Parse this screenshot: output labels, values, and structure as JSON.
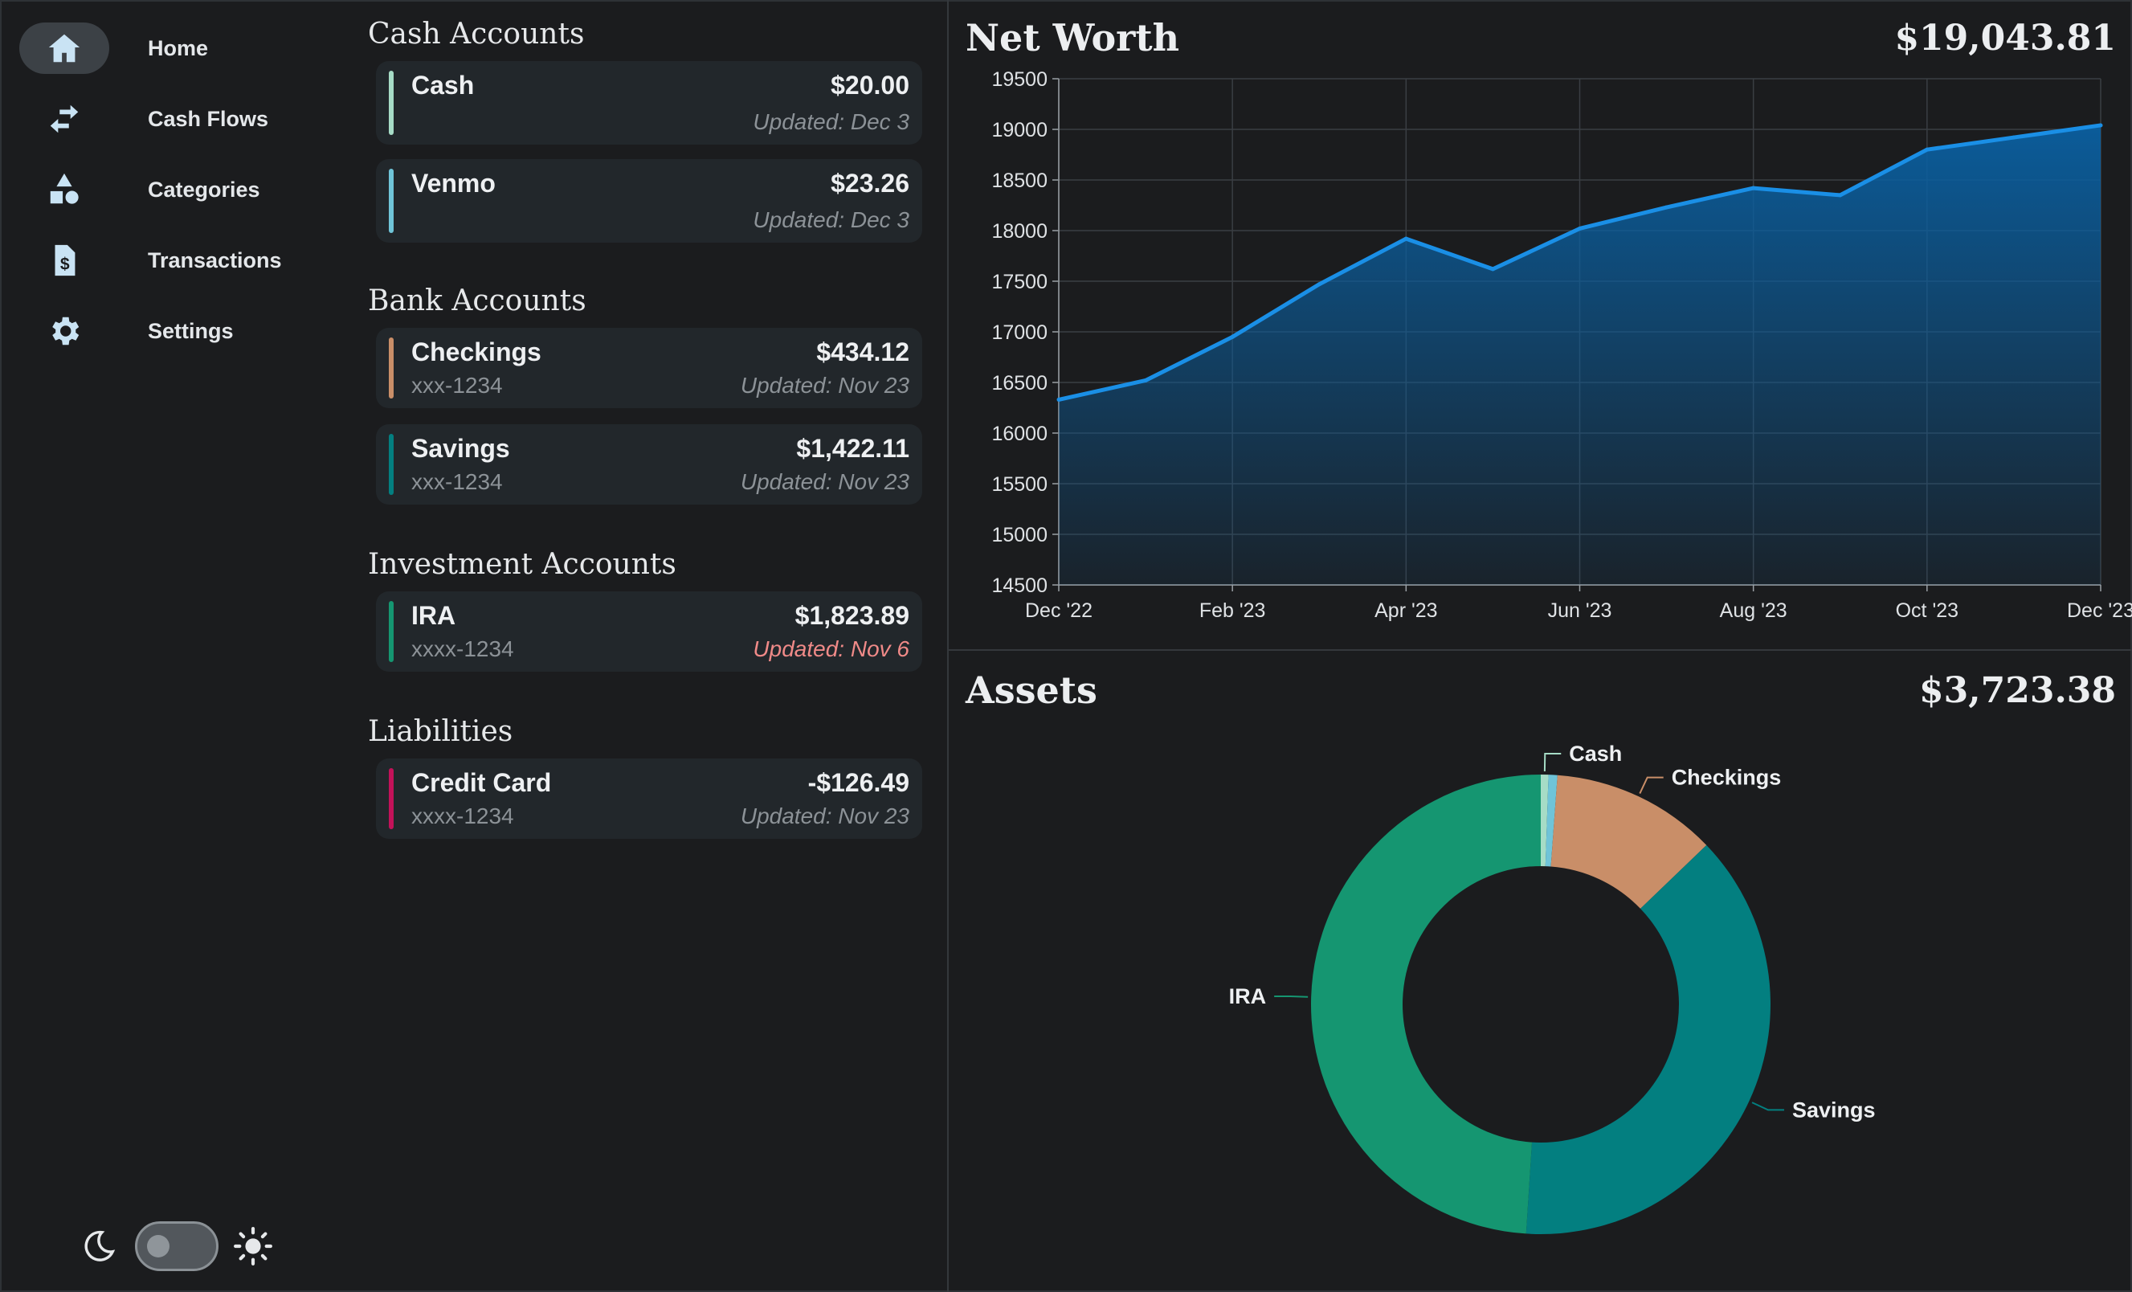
{
  "sidebar": {
    "items": [
      {
        "label": "Home",
        "icon": "home-icon",
        "active": true
      },
      {
        "label": "Cash Flows",
        "icon": "arrows-swap-icon",
        "active": false
      },
      {
        "label": "Categories",
        "icon": "shapes-icon",
        "active": false
      },
      {
        "label": "Transactions",
        "icon": "receipt-dollar-icon",
        "active": false
      },
      {
        "label": "Settings",
        "icon": "gear-icon",
        "active": false
      }
    ],
    "theme_toggle": {
      "dark_icon": "moon-icon",
      "light_icon": "sun-icon",
      "state": "dark"
    }
  },
  "accounts": {
    "sections": [
      {
        "title": "Cash Accounts",
        "cards": [
          {
            "name": "Cash",
            "amount": "$20.00",
            "sub": "",
            "updated": "Updated: Dec 3",
            "color": "#a6dcc6",
            "stale": false
          },
          {
            "name": "Venmo",
            "amount": "$23.26",
            "sub": "",
            "updated": "Updated: Dec 3",
            "color": "#6fc4d8",
            "stale": false
          }
        ]
      },
      {
        "title": "Bank Accounts",
        "cards": [
          {
            "name": "Checkings",
            "amount": "$434.12",
            "sub": "xxx-1234",
            "updated": "Updated: Nov 23",
            "color": "#c98e68",
            "stale": false
          },
          {
            "name": "Savings",
            "amount": "$1,422.11",
            "sub": "xxx-1234",
            "updated": "Updated: Nov 23",
            "color": "#037f80",
            "stale": false
          }
        ]
      },
      {
        "title": "Investment Accounts",
        "cards": [
          {
            "name": "IRA",
            "amount": "$1,823.89",
            "sub": "xxxx-1234",
            "updated": "Updated: Nov 6",
            "color": "#159671",
            "stale": true
          }
        ]
      },
      {
        "title": "Liabilities",
        "cards": [
          {
            "name": "Credit Card",
            "amount": "-$126.49",
            "sub": "xxxx-1234",
            "updated": "Updated: Nov 23",
            "color": "#c21259",
            "stale": false
          }
        ]
      }
    ]
  },
  "net_worth": {
    "title": "Net Worth",
    "value": "$19,043.81"
  },
  "assets": {
    "title": "Assets",
    "value": "$3,723.38"
  },
  "chart_data": [
    {
      "type": "area",
      "title": "Net Worth",
      "x": [
        "Dec '22",
        "Jan '23",
        "Feb '23",
        "Mar '23",
        "Apr '23",
        "May '23",
        "Jun '23",
        "Jul '23",
        "Aug '23",
        "Sep '23",
        "Oct '23",
        "Nov '23",
        "Dec '23"
      ],
      "series": [
        {
          "values": [
            16330,
            16520,
            16950,
            17470,
            17920,
            17620,
            18020,
            18230,
            18420,
            18350,
            18800,
            18920,
            19040
          ]
        }
      ],
      "x_tick_labels": [
        "Dec '22",
        "Feb '23",
        "Apr '23",
        "Jun '23",
        "Aug '23",
        "Oct '23",
        "Dec '23"
      ],
      "y_ticks": [
        14500,
        15000,
        15500,
        16000,
        16500,
        17000,
        17500,
        18000,
        18500,
        19000,
        19500
      ],
      "ylim": [
        14500,
        19500
      ],
      "grid": true,
      "colors": {
        "line": "#1a8fe6",
        "fill": "#0a5fa0"
      }
    },
    {
      "type": "pie",
      "title": "Assets",
      "donut": true,
      "slices": [
        {
          "label": "Cash",
          "value": 20.0,
          "color": "#a6dcc6"
        },
        {
          "label": "",
          "value": 23.26,
          "color": "#6fc4d8"
        },
        {
          "label": "Checkings",
          "value": 434.12,
          "color": "#c98e68"
        },
        {
          "label": "Savings",
          "value": 1422.11,
          "color": "#037f80"
        },
        {
          "label": "IRA",
          "value": 1823.89,
          "color": "#159671"
        }
      ]
    }
  ]
}
